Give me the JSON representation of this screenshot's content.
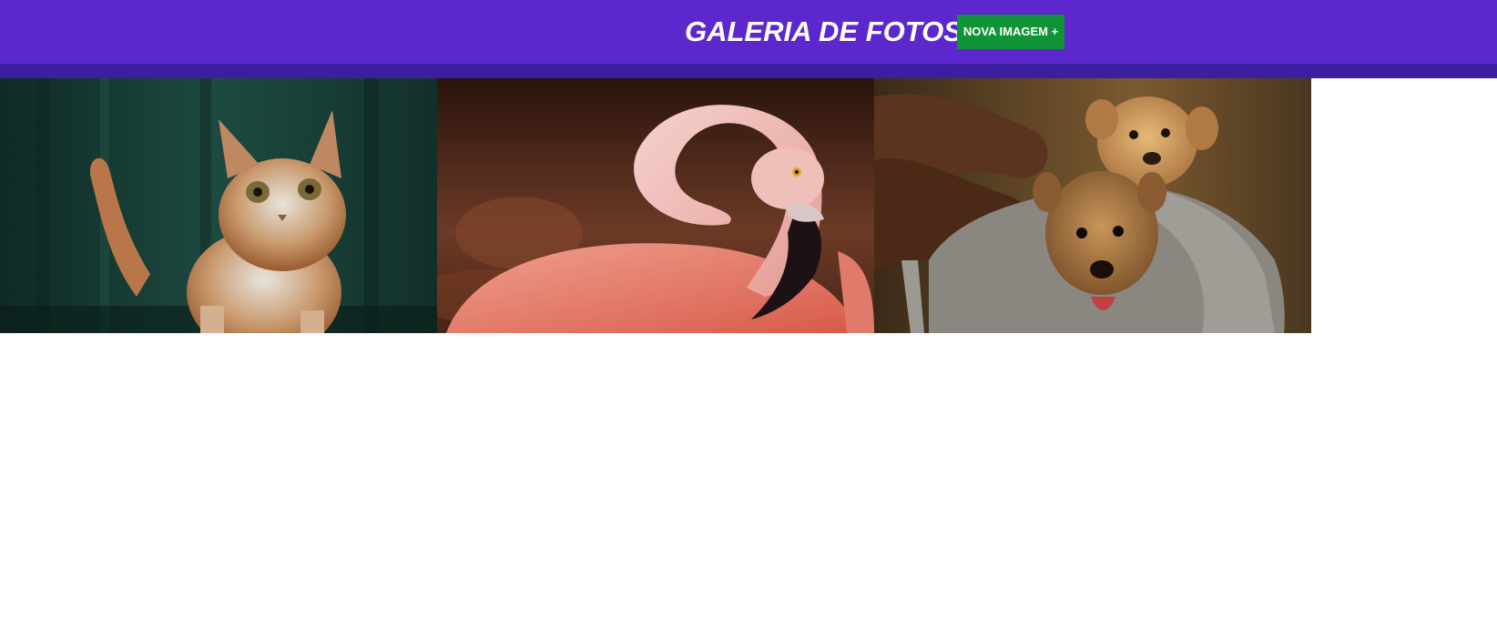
{
  "header": {
    "title": "GALERIA DE FOTOS",
    "new_image_label": "NOVA IMAGEM +"
  },
  "colors": {
    "header_bg": "#5c28cd",
    "header_strip": "#3c1fa0",
    "button_bg": "#0e9436",
    "text": "#ffffff"
  },
  "gallery": {
    "photos": [
      {
        "subject": "cat",
        "icon": "cat-photo"
      },
      {
        "subject": "flamingo",
        "icon": "flamingo-photo"
      },
      {
        "subject": "puppies",
        "icon": "puppies-photo"
      }
    ]
  }
}
